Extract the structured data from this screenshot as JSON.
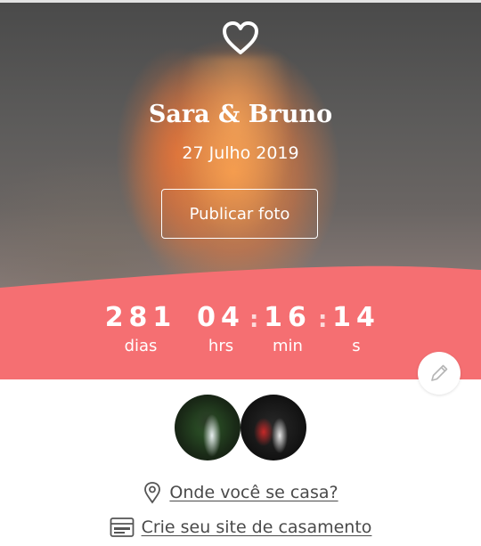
{
  "hero": {
    "couple_name": "Sara & Bruno",
    "date": "27 Julho 2019",
    "publish_button": "Publicar foto"
  },
  "countdown": {
    "days": "281",
    "days_label": "dias",
    "hours": "04",
    "hours_label": "hrs",
    "minutes": "16",
    "minutes_label": "min",
    "seconds": "14",
    "seconds_label": "s",
    "separator": ":"
  },
  "links": {
    "venue": "Onde você se casa?",
    "website": "Crie seu site de casamento"
  },
  "icons": {
    "top": "heart-icon",
    "edit": "pencil-icon",
    "venue": "location-pin-icon",
    "website": "browser-window-icon"
  },
  "colors": {
    "accent": "#f56f72",
    "text": "#444444"
  }
}
